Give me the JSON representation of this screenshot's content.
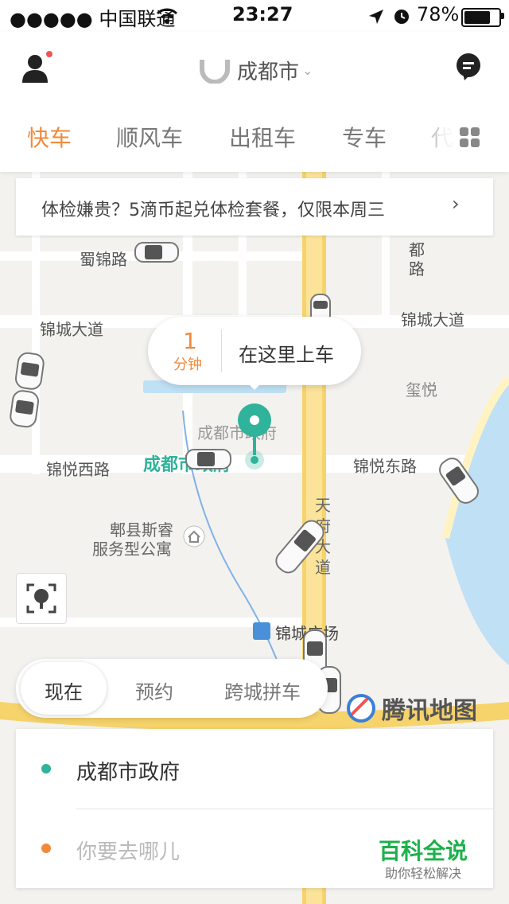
{
  "status_bar": {
    "carrier": "●●●●● 中国联通",
    "time": "23:27",
    "battery_percent": "78%",
    "icons": [
      "wifi-icon",
      "location-arrow-icon",
      "alarm-icon",
      "battery-icon"
    ]
  },
  "header": {
    "city": "成都市",
    "profile_icon": "user-icon",
    "message_icon": "chat-bubble-icon",
    "tabs": [
      {
        "label": "快车",
        "active": true
      },
      {
        "label": "顺风车",
        "active": false
      },
      {
        "label": "出租车",
        "active": false
      },
      {
        "label": "专车",
        "active": false
      },
      {
        "label": "代",
        "active": false
      }
    ],
    "more_icon": "grid-icon"
  },
  "banner": {
    "text": "体检嫌贵？5滴币起兑体检套餐，仅限本周三"
  },
  "map": {
    "labels": {
      "shujin": "蜀锦路",
      "jincheng_w": "锦城大道",
      "jincheng_e": "锦城大道",
      "jinyue_w": "锦悦西路",
      "jinyue_e": "锦悦东路",
      "xiyue": "玺悦",
      "zhengfu": "成都市政府",
      "zhengfu_grey": "成都市政府",
      "tianfu": "天府大道",
      "apt1": "郫县斯睿",
      "apt2": "服务型公寓",
      "guangchang": "锦城广场",
      "road_vertical": "都路",
      "watermark": "腾讯地图"
    },
    "pickup_bubble": {
      "minutes": "1",
      "unit": "分钟",
      "text": "在这里上车"
    }
  },
  "modes": [
    {
      "label": "现在",
      "active": true
    },
    {
      "label": "预约",
      "active": false
    },
    {
      "label": "跨城拼车",
      "active": false
    }
  ],
  "trip": {
    "from": "成都市政府",
    "to_placeholder": "你要去哪儿"
  },
  "watermark": {
    "title": "百科全说",
    "subtitle": "助你轻松解决"
  },
  "colors": {
    "accent": "#f08a3c",
    "pin": "#2fb39a",
    "road": "#f6d36b"
  }
}
